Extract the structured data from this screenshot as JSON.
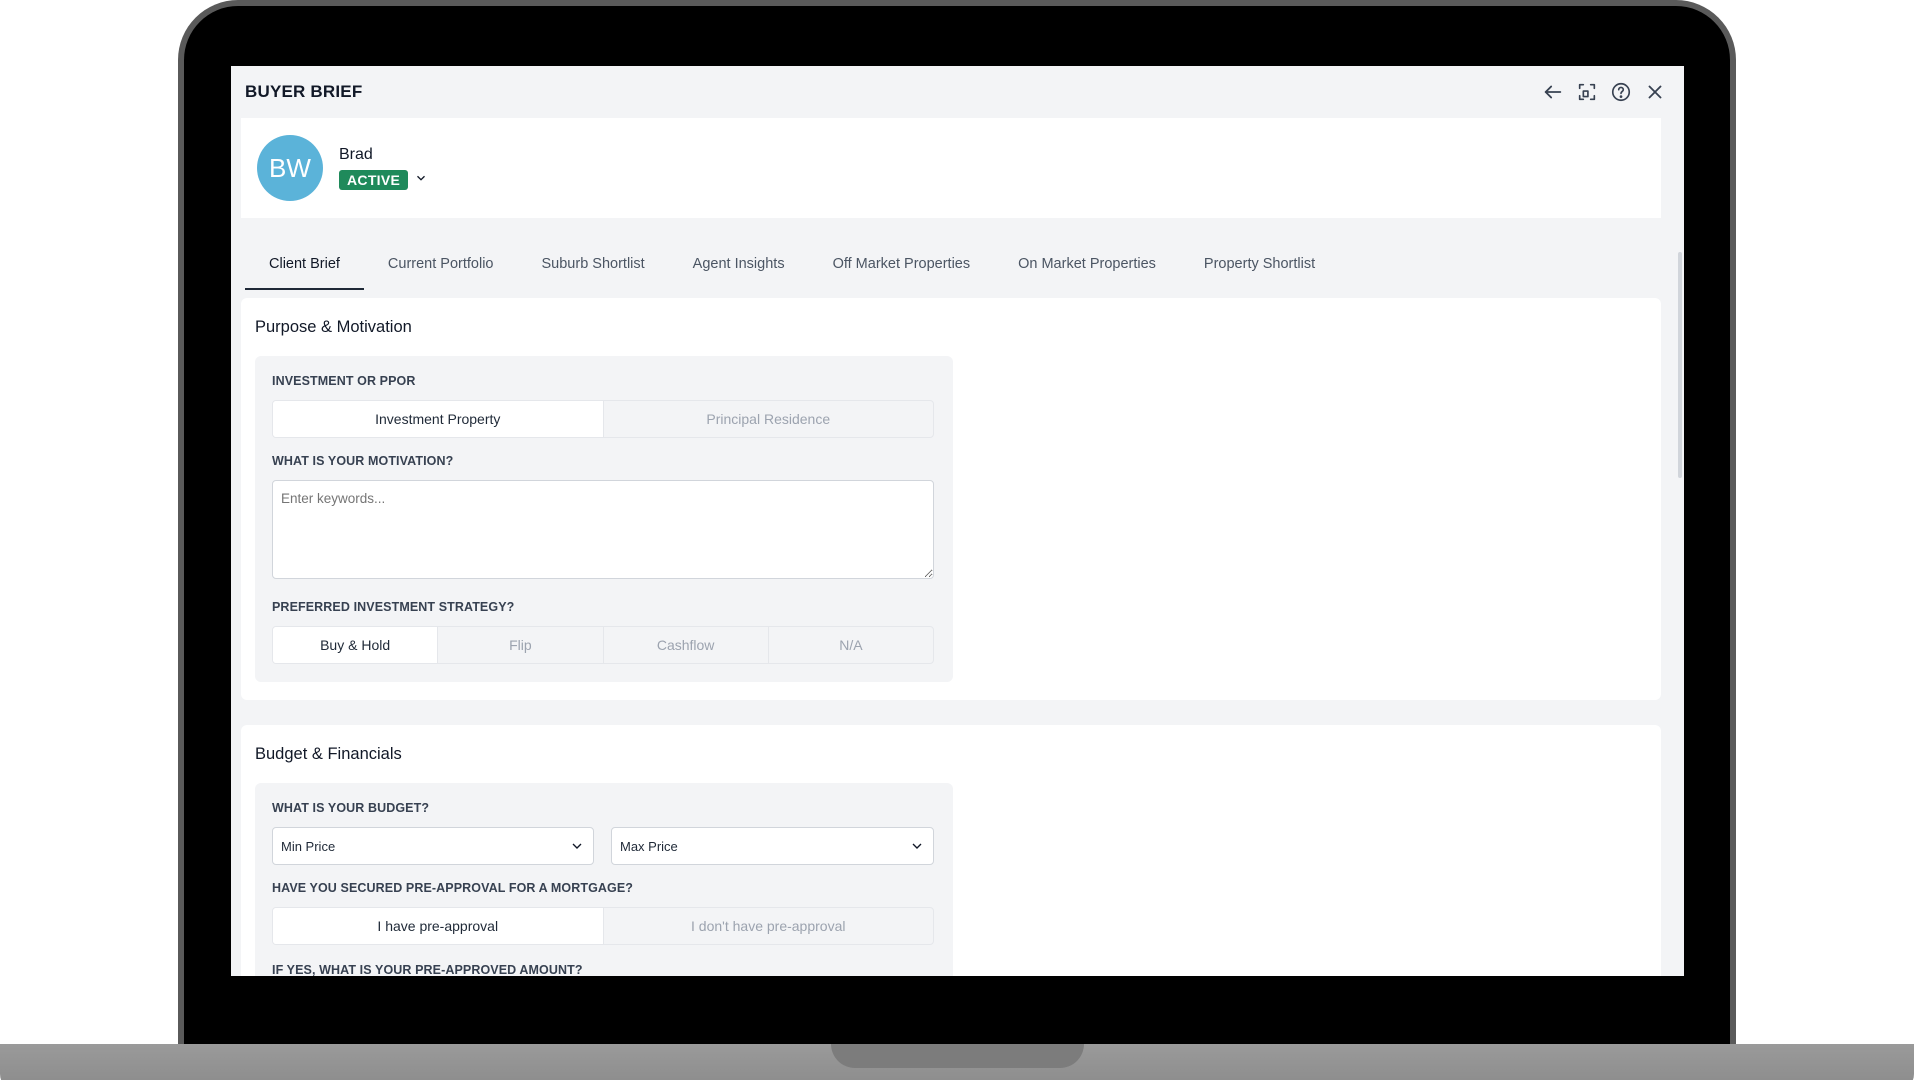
{
  "window": {
    "title": "BUYER BRIEF",
    "icons": [
      "arrow-left-icon",
      "focus-icon",
      "help-icon",
      "close-icon"
    ]
  },
  "profile": {
    "initials": "BW",
    "name": "Brad",
    "status": "ACTIVE",
    "avatar_color": "#5bb3d9",
    "status_color": "#1f8a5b"
  },
  "tabs": [
    {
      "label": "Client Brief",
      "active": true
    },
    {
      "label": "Current Portfolio",
      "active": false
    },
    {
      "label": "Suburb Shortlist",
      "active": false
    },
    {
      "label": "Agent Insights",
      "active": false
    },
    {
      "label": "Off Market Properties",
      "active": false
    },
    {
      "label": "On Market Properties",
      "active": false
    },
    {
      "label": "Property Shortlist",
      "active": false
    }
  ],
  "purpose": {
    "title": "Purpose & Motivation",
    "investment_label": "INVESTMENT OR PPOR",
    "investment_options": [
      "Investment Property",
      "Principal Residence"
    ],
    "investment_selected": "Investment Property",
    "motivation_label": "WHAT IS YOUR MOTIVATION?",
    "motivation_placeholder": "Enter keywords...",
    "motivation_value": "",
    "strategy_label": "PREFERRED INVESTMENT STRATEGY?",
    "strategy_options": [
      "Buy & Hold",
      "Flip",
      "Cashflow",
      "N/A"
    ],
    "strategy_selected": "Buy & Hold"
  },
  "budget": {
    "title": "Budget & Financials",
    "budget_label": "WHAT IS YOUR BUDGET?",
    "min_price": "Min Price",
    "max_price": "Max Price",
    "preapproval_label": "HAVE YOU SECURED PRE-APPROVAL FOR A MORTGAGE?",
    "preapproval_options": [
      "I have pre-approval",
      "I don't have pre-approval"
    ],
    "preapproval_selected": "I have pre-approval",
    "preapproved_amount_label": "IF YES, WHAT IS YOUR PRE-APPROVED AMOUNT?"
  }
}
